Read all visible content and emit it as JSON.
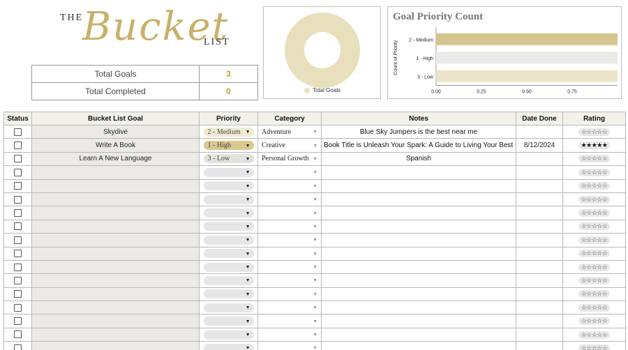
{
  "logo": {
    "the": "THE",
    "bucket": "Bucket",
    "list": "LIST"
  },
  "summary": [
    {
      "label": "Total Goals",
      "value": "3"
    },
    {
      "label": "Total Completed",
      "value": "0"
    }
  ],
  "donut": {
    "legend": "Total Goals",
    "color": "#e8dfbd"
  },
  "chart_data": {
    "type": "bar",
    "orientation": "horizontal",
    "title": "Goal Priority Count",
    "ylabel": "Count of Priority",
    "categories": [
      "2 - Medium",
      "1 - High",
      "3 - Low"
    ],
    "values": [
      1,
      1,
      1
    ],
    "colors": [
      "#d4c58e",
      "#ebeae6",
      "#ece5c9"
    ],
    "xticks": [
      "0.00",
      "0.25",
      "0.50",
      "0.75"
    ],
    "xlim": [
      0,
      1
    ]
  },
  "table": {
    "headers": [
      "Status",
      "Bucket List Goal",
      "Priority",
      "Category",
      "Notes",
      "Date Done",
      "Rating"
    ],
    "rows": [
      {
        "goal": "Skydive",
        "priority": "2 - Medium",
        "pclass": "p2",
        "category": "Adventure",
        "notes": "Blue Sky Jumpers is the best near me",
        "date": "",
        "rating": "☆☆☆☆☆"
      },
      {
        "goal": "Write A Book",
        "priority": "1 - High",
        "pclass": "p1",
        "category": "Creative",
        "notes": "Book Title is Unleash Your Spark: A Guide to Living Your Best Life",
        "date": "8/12/2024",
        "rating": "★★★★★"
      },
      {
        "goal": "Learn A New Language",
        "priority": "3 - Low",
        "pclass": "p3",
        "category": "Personal Growth",
        "notes": "Spanish",
        "date": "",
        "rating": "☆☆☆☆☆"
      }
    ],
    "empty_rating": "☆☆☆☆☆",
    "empty_rows": 14
  }
}
